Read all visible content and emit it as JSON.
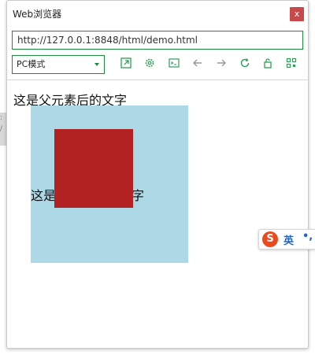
{
  "window": {
    "title": "Web浏览器",
    "close_label": "x"
  },
  "address_bar": {
    "url": "http://127.0.0.1:8848/html/demo.html"
  },
  "toolbar": {
    "mode_selected": "PC模式",
    "icons": [
      "open-external-icon",
      "settings-icon",
      "console-icon",
      "back-icon",
      "forward-icon",
      "refresh-icon",
      "lock-icon",
      "qr-code-icon"
    ]
  },
  "page": {
    "after_text": "这是父元素后的文字",
    "inner_text": "这是父元素内的文字",
    "parent_color": "#add8e6",
    "child_color": "#b22222"
  },
  "ime": {
    "logo": "S",
    "language": "英",
    "punct": "•,"
  },
  "colors": {
    "accent": "#1d8a3f",
    "close": "#c7494a"
  }
}
